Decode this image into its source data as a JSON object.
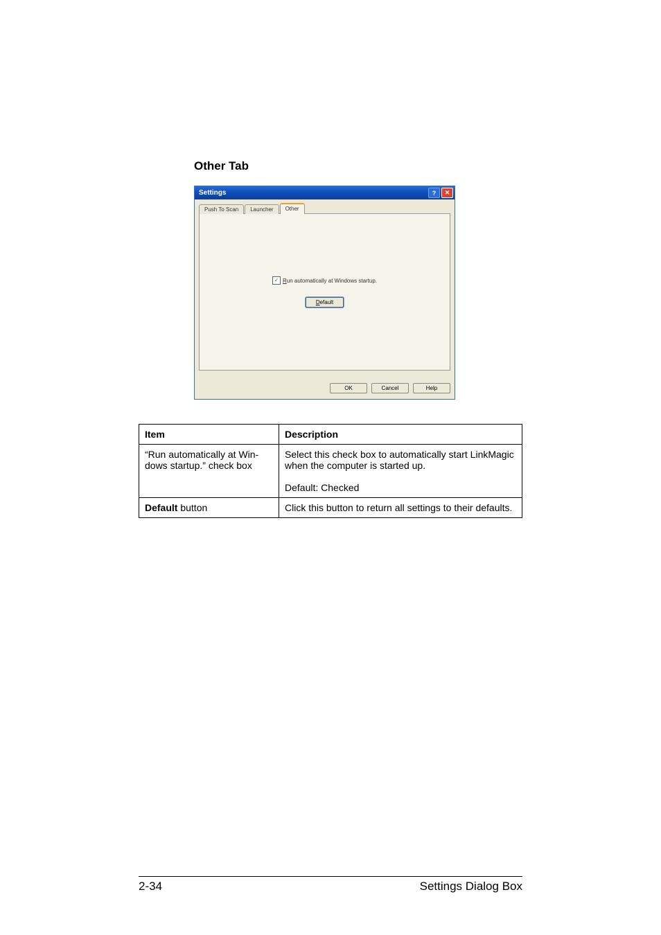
{
  "heading": "Other Tab",
  "dialog": {
    "title": "Settings",
    "help_btn": "?",
    "close_btn": "✕",
    "tabs": {
      "push": "Push To Scan",
      "launcher": "Launcher",
      "other": "Other"
    },
    "checkbox_label_pre": "R",
    "checkbox_label_rest": "un automatically at Windows startup.",
    "default_btn_pre": "D",
    "default_btn_rest": "efault",
    "ok": "OK",
    "cancel": "Cancel",
    "help": "Help"
  },
  "table": {
    "head": {
      "item": "Item",
      "description": "Description"
    },
    "rows": [
      {
        "item": "“Run automatically at Win­dows startup.” check box",
        "desc": "Select this check box to automatically start LinkMagic when the computer is started up.\n\nDefault: Checked"
      },
      {
        "item_bold": "Default",
        "item_rest": " button",
        "desc": "Click this button to return all settings to their defaults."
      }
    ]
  },
  "footer": {
    "page": "2-34",
    "section": "Settings Dialog Box"
  }
}
